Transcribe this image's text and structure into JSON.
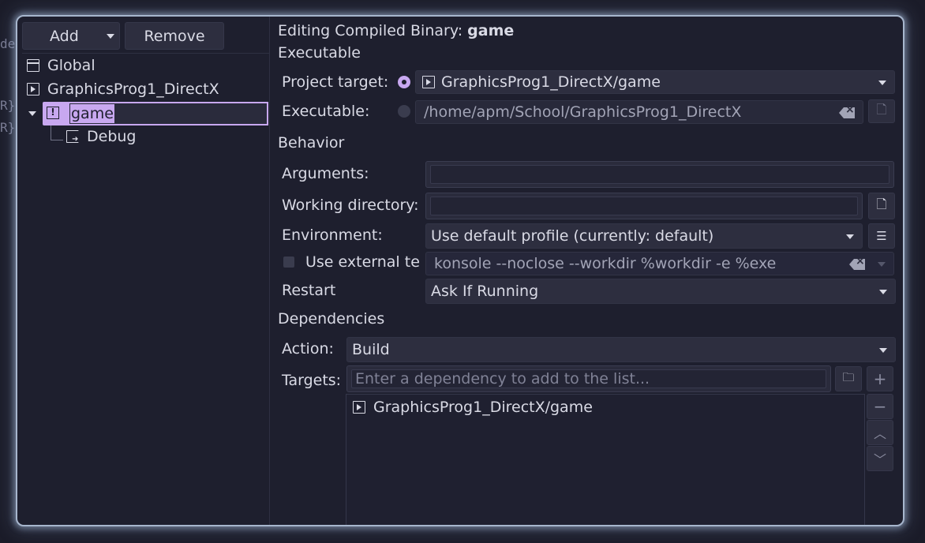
{
  "background": {
    "fragments": [
      "de",
      "R}",
      "R}"
    ]
  },
  "left": {
    "add_label": "Add",
    "remove_label": "Remove",
    "tree": [
      {
        "label": "Global",
        "icon": "folder-icon"
      },
      {
        "label": "GraphicsProg1_DirectX",
        "icon": "executable-target-icon"
      },
      {
        "label": "game",
        "icon": "warning-target-icon",
        "editing": true
      },
      {
        "label": "Debug",
        "icon": "launch-config-icon"
      }
    ]
  },
  "header": {
    "prefix": "Editing Compiled Binary:",
    "name": "game"
  },
  "executable": {
    "section": "Executable",
    "project_target_label": "Project target:",
    "project_target_value": "GraphicsProg1_DirectX/game",
    "executable_label": "Executable:",
    "executable_value": "/home/apm/School/GraphicsProg1_DirectX"
  },
  "behavior": {
    "section": "Behavior",
    "arguments_label": "Arguments:",
    "arguments_value": "",
    "workdir_label": "Working directory:",
    "workdir_value": "",
    "environment_label": "Environment:",
    "environment_value": "Use default profile (currently: default)",
    "external_terminal_label": "Use external te",
    "external_terminal_value": "konsole --noclose --workdir %workdir -e %exe",
    "restart_label": "Restart",
    "restart_value": "Ask If Running"
  },
  "dependencies": {
    "section": "Dependencies",
    "action_label": "Action:",
    "action_value": "Build",
    "targets_label": "Targets:",
    "targets_placeholder": "Enter a dependency to add to the list...",
    "items": [
      "GraphicsProg1_DirectX/game"
    ]
  },
  "colors": {
    "accent": "#c8a8f0",
    "panel": "#1e1f2e",
    "glow": "#a7b6cd"
  }
}
